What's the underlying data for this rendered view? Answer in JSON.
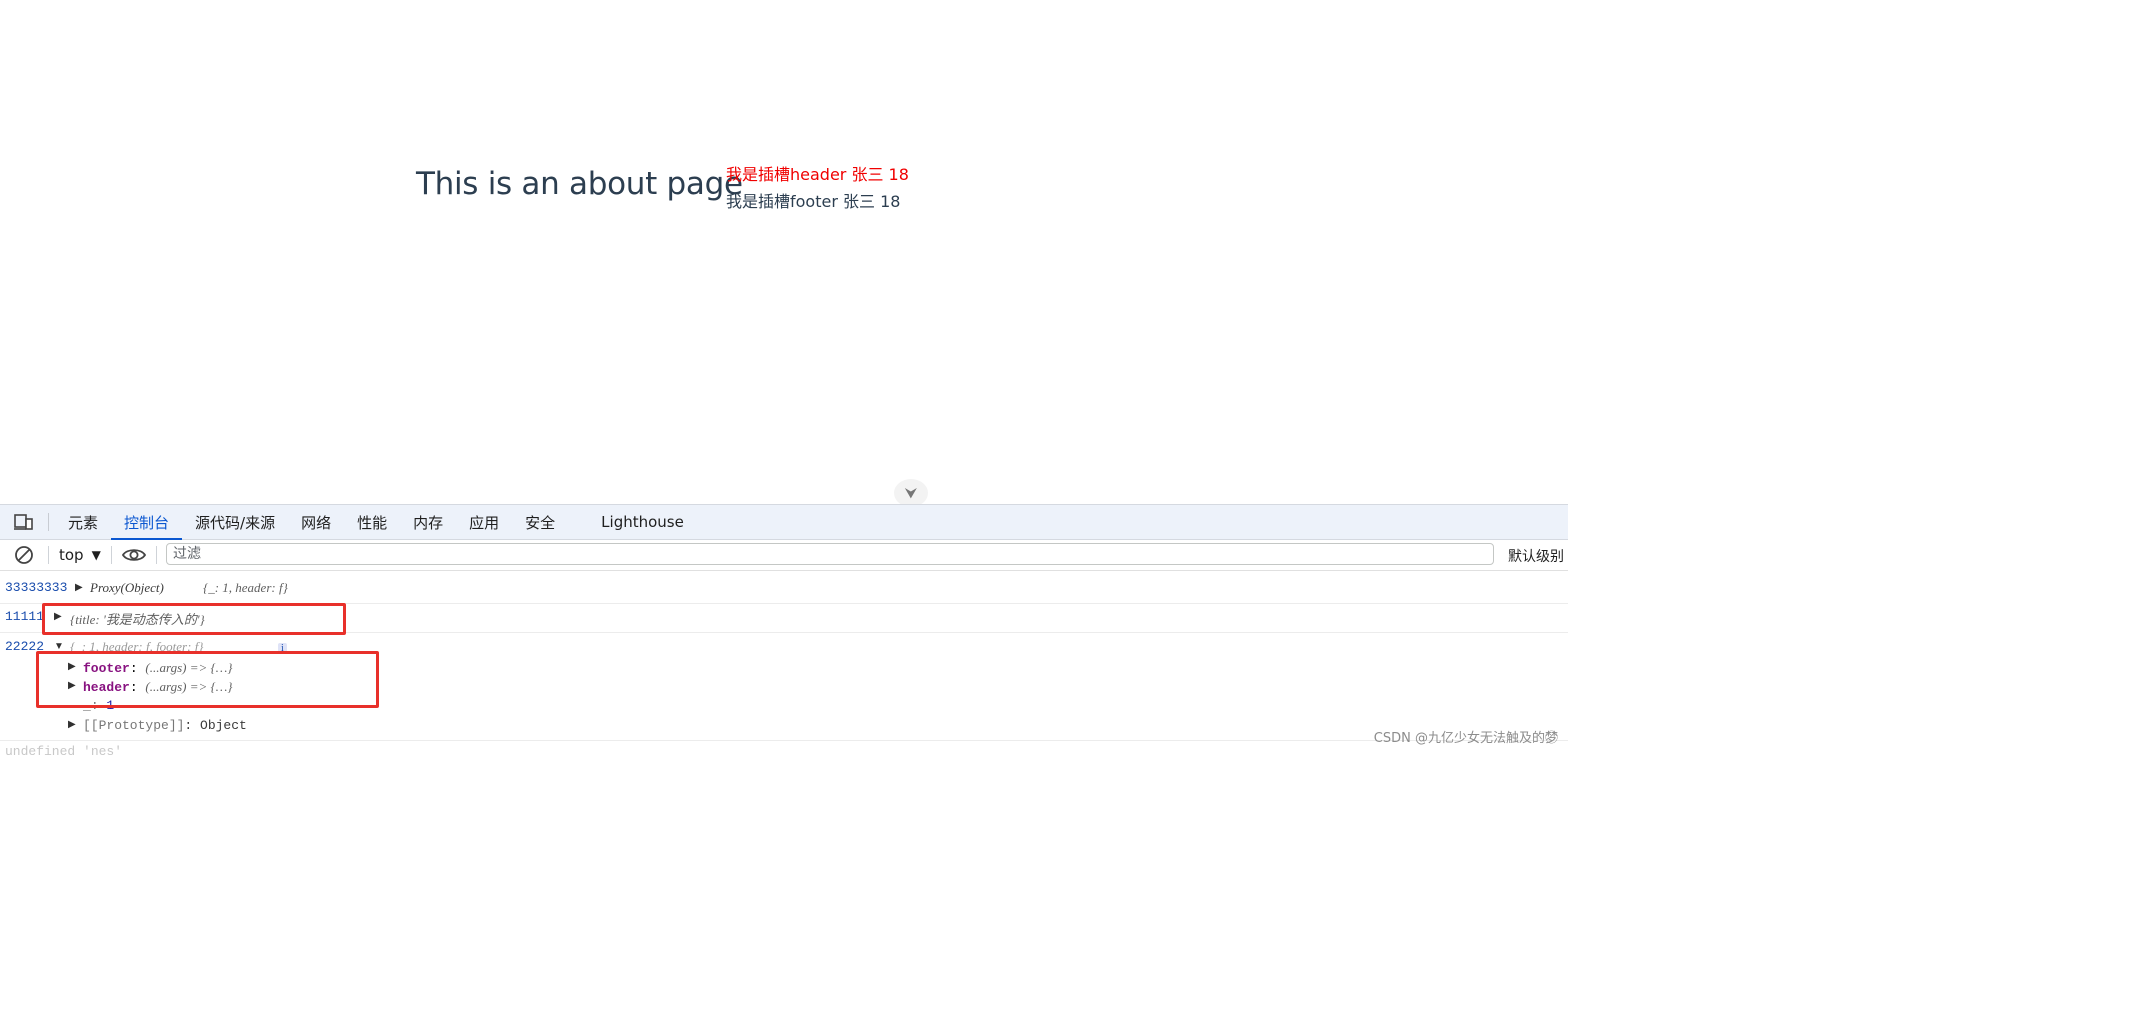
{
  "page": {
    "title": "This is an about page",
    "slot_header": "我是插槽header 张三 18",
    "slot_footer": "我是插槽footer 张三 18",
    "devtools_toggle_glyph": "⮟"
  },
  "devtools": {
    "tabs": [
      {
        "label": "元素"
      },
      {
        "label": "控制台"
      },
      {
        "label": "源代码/来源"
      },
      {
        "label": "网络"
      },
      {
        "label": "性能"
      },
      {
        "label": "内存"
      },
      {
        "label": "应用"
      },
      {
        "label": "安全"
      },
      {
        "label": "Lighthouse"
      }
    ],
    "active_tab": "控制台",
    "toolbar": {
      "context": "top",
      "filter_placeholder": "过滤",
      "level": "默认级别"
    },
    "console": {
      "msg1": {
        "prefix": "33333333",
        "label": "Proxy(Object)",
        "preview": "{_: 1, header: f}"
      },
      "msg2": {
        "prefix": "11111",
        "preview": "{title: '我是动态传入的'}"
      },
      "msg3": {
        "prefix": "22222",
        "preview": "{_: 1, header: f, footer: f}",
        "badge": "i",
        "footer_key": "footer",
        "footer_val": "(...args) => {…}",
        "header_key": "header",
        "header_val": "(...args) => {…}",
        "underscore_key": "_",
        "underscore_val": "1",
        "proto_key": "[[Prototype]]",
        "proto_val": "Object"
      },
      "msg4_partial": "undefined 'nes'"
    }
  },
  "watermark": "CSDN @九亿少女无法触及的梦⃝",
  "colors": {
    "active_tab": "#0b57d0",
    "highlight_box": "#e8302a",
    "slot_header_text": "#f00000"
  }
}
